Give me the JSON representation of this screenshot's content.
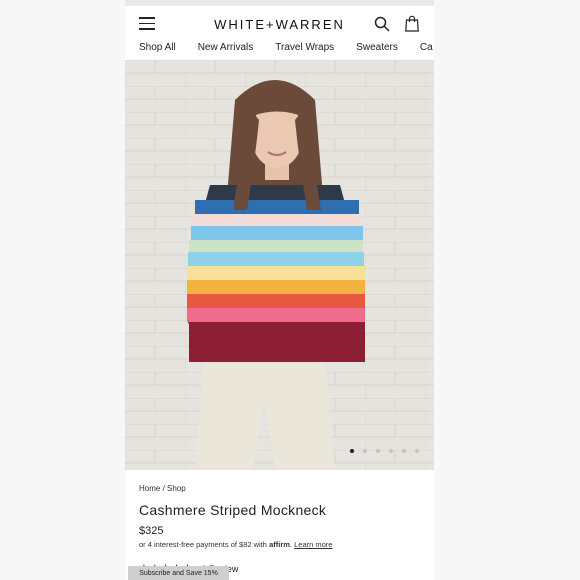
{
  "brand": {
    "name": "WHITE+WARREN"
  },
  "header": {
    "menu_icon": "hamburger-icon",
    "search_icon": "search-icon",
    "bag_icon": "shopping-bag-icon"
  },
  "nav": [
    "Shop All",
    "New Arrivals",
    "Travel Wraps",
    "Sweaters",
    "Ca"
  ],
  "hero": {
    "slide_count": 6,
    "active_slide": 1
  },
  "product": {
    "breadcrumb": {
      "home": "Home",
      "separator": "/",
      "shop": "Shop"
    },
    "title": "Cashmere Striped Mockneck",
    "price": "$325",
    "affirm": {
      "prefix": "or 4 interest-free payments of $82 with",
      "logo": "affirm",
      "separator": ".",
      "link": "Learn more"
    },
    "rating": {
      "stars": "★★★★★",
      "value": 5,
      "count_label": "1 Review"
    }
  },
  "subscribe": {
    "label": "Subscribe and Save 15%"
  }
}
